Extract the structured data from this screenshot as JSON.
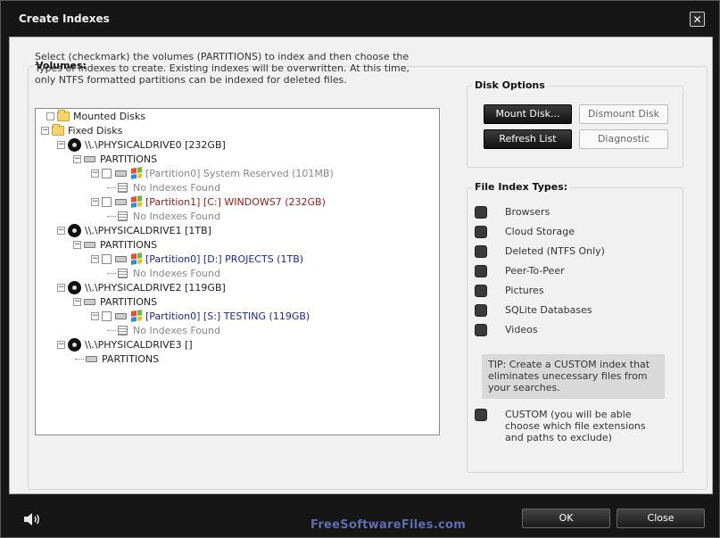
{
  "window": {
    "title": "Create Indexes"
  },
  "volumes": {
    "legend": "Volumes:",
    "description": "Select (checkmark) the volumes (PARTITIONS) to index and then choose the Types of indexes to create.  Existing indexes will be overwritten.  At this time, only NTFS formatted partitions can be indexed for deleted files."
  },
  "tree": {
    "mounted": "Mounted Disks",
    "fixed": "Fixed Disks",
    "drive0": "\\\\.\\PHYSICALDRIVE0 [232GB]",
    "drive0_partitions": "PARTITIONS",
    "d0p0": "[Partition0]  System Reserved (101MB)",
    "d0p0_idx": "No Indexes Found",
    "d0p1": "[Partition1] [C:] WINDOWS7 (232GB)",
    "d0p1_idx": "No Indexes Found",
    "drive1": "\\\\.\\PHYSICALDRIVE1 [1TB]",
    "drive1_partitions": "PARTITIONS",
    "d1p0": "[Partition0] [D:] PROJECTS (1TB)",
    "d1p0_idx": "No Indexes Found",
    "drive2": "\\\\.\\PHYSICALDRIVE2 [119GB]",
    "drive2_partitions": "PARTITIONS",
    "d2p0": "[Partition0] [S:] TESTING (119GB)",
    "d2p0_idx": "No Indexes Found",
    "drive3": "\\\\.\\PHYSICALDRIVE3 []",
    "drive3_partitions": "PARTITIONS"
  },
  "disk_options": {
    "legend": "Disk Options",
    "mount": "Mount Disk...",
    "dismount": "Dismount Disk",
    "refresh": "Refresh List",
    "diagnostic": "Diagnostic"
  },
  "file_index_types": {
    "legend": "File Index Types:",
    "items": [
      "Browsers",
      "Cloud Storage",
      "Deleted (NTFS Only)",
      "Peer-To-Peer",
      "Pictures",
      "SQLite Databases",
      "Videos"
    ],
    "tip": "TIP:  Create a CUSTOM index that eliminates unecessary files from your searches.",
    "custom": "CUSTOM (you will be able choose which file extensions and paths to exclude)"
  },
  "footer": {
    "ok": "OK",
    "close": "Close",
    "watermark": "FreeSoftwareFiles.com"
  }
}
